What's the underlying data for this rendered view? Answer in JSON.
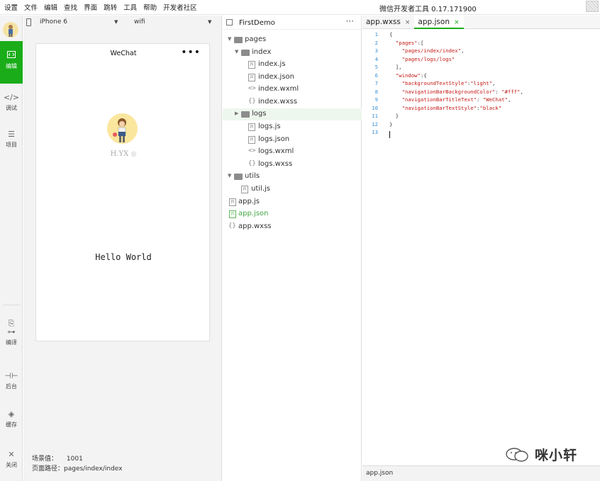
{
  "menubar": {
    "items": [
      "设置",
      "文件",
      "编辑",
      "查找",
      "界面",
      "跳转",
      "工具",
      "帮助",
      "开发者社区"
    ],
    "title": "微信开发者工具 0.17.171900"
  },
  "leftbar": {
    "items": [
      {
        "label": "编辑",
        "icon": "code-icon",
        "active": true
      },
      {
        "label": "调试",
        "icon": "debug-icon"
      },
      {
        "label": "项目",
        "icon": "list-icon"
      },
      {
        "label": "编译",
        "icon": "compile-icon"
      },
      {
        "label": "后台",
        "icon": "background-icon"
      },
      {
        "label": "缓存",
        "icon": "cache-icon"
      },
      {
        "label": "关闭",
        "icon": "close-icon"
      }
    ]
  },
  "simulator": {
    "device": "iPhone 6",
    "network": "wifi",
    "nav_title": "WeChat",
    "menu_dots": "•••",
    "nickname": "H.YX",
    "hello": "Hello World",
    "scene_label": "场景值：",
    "scene_value": "1001",
    "path_label": "页面路径：",
    "path_value": "pages/index/index"
  },
  "filetree": {
    "project": "FirstDemo",
    "more": "···",
    "nodes": [
      {
        "name": "pages"
      },
      {
        "name": "index"
      },
      {
        "name": "index.js",
        "type": "JS"
      },
      {
        "name": "index.json",
        "type": "JSON"
      },
      {
        "name": "index.wxml",
        "type": "<>"
      },
      {
        "name": "index.wxss",
        "type": "{}"
      },
      {
        "name": "logs"
      },
      {
        "name": "logs.js",
        "type": "JS"
      },
      {
        "name": "logs.json",
        "type": "JSON"
      },
      {
        "name": "logs.wxml",
        "type": "<>"
      },
      {
        "name": "logs.wxss",
        "type": "{}"
      },
      {
        "name": "utils"
      },
      {
        "name": "util.js",
        "type": "JS"
      },
      {
        "name": "app.js",
        "type": "JS"
      },
      {
        "name": "app.json",
        "type": "JSON"
      },
      {
        "name": "app.wxss",
        "type": "{}"
      }
    ]
  },
  "editor": {
    "tabs": [
      {
        "label": "app.wxss"
      },
      {
        "label": "app.json"
      }
    ],
    "tab_close": "×",
    "line_numbers": [
      "1",
      "2",
      "3",
      "4",
      "5",
      "6",
      "7",
      "8",
      "9",
      "10",
      "11",
      "12",
      "13"
    ],
    "status_file": "app.json"
  },
  "watermark": {
    "text": "咪小轩"
  },
  "colors": {
    "accent": "#1aad19",
    "string": "#c41a16",
    "line_number": "#3a8fd0"
  }
}
